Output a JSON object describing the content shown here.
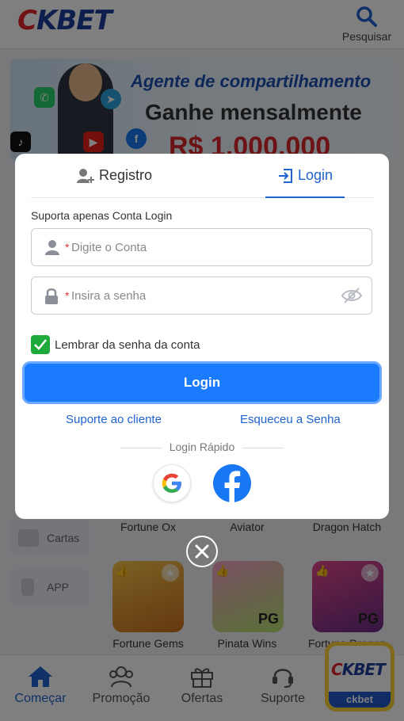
{
  "header": {
    "logo_c": "C",
    "logo_k": "K",
    "logo_bet": "BET",
    "search_label": "Pesquisar"
  },
  "banner": {
    "line1": "Agente de compartilhamento",
    "line2": "Ganhe mensalmente",
    "line3": "R$ 1.000.000"
  },
  "sidebar": {
    "items": [
      {
        "label": "Cartas"
      },
      {
        "label": "APP"
      }
    ]
  },
  "games": {
    "row1": [
      "Fortune Ox",
      "Aviator",
      "Dragon Hatch"
    ],
    "row2": [
      "Fortune Gems",
      "Pinata Wins",
      "Fortune Dragon"
    ],
    "badge_pg": "PG"
  },
  "bottom_nav": [
    {
      "label": "Começar",
      "icon": "home-icon"
    },
    {
      "label": "Promoção",
      "icon": "group-icon"
    },
    {
      "label": "Ofertas",
      "icon": "gift-icon"
    },
    {
      "label": "Suporte",
      "icon": "headset-icon"
    }
  ],
  "floating_app": {
    "label": "ckbet"
  },
  "modal": {
    "tab_register": "Registro",
    "tab_login": "Login",
    "note": "Suporta apenas Conta Login",
    "account_placeholder": "Digite o Conta",
    "password_placeholder": "Insira a senha",
    "required_mark": "*",
    "remember_label": "Lembrar da senha da conta",
    "remember_checked": true,
    "login_button": "Login",
    "support_link": "Suporte ao cliente",
    "forgot_link": "Esqueceu a Senha",
    "quick_login": "Login Rápido"
  },
  "colors": {
    "accent": "#1f63ce",
    "button": "#1a7bff",
    "checkbox": "#1faa3c",
    "required": "#e0353b"
  }
}
